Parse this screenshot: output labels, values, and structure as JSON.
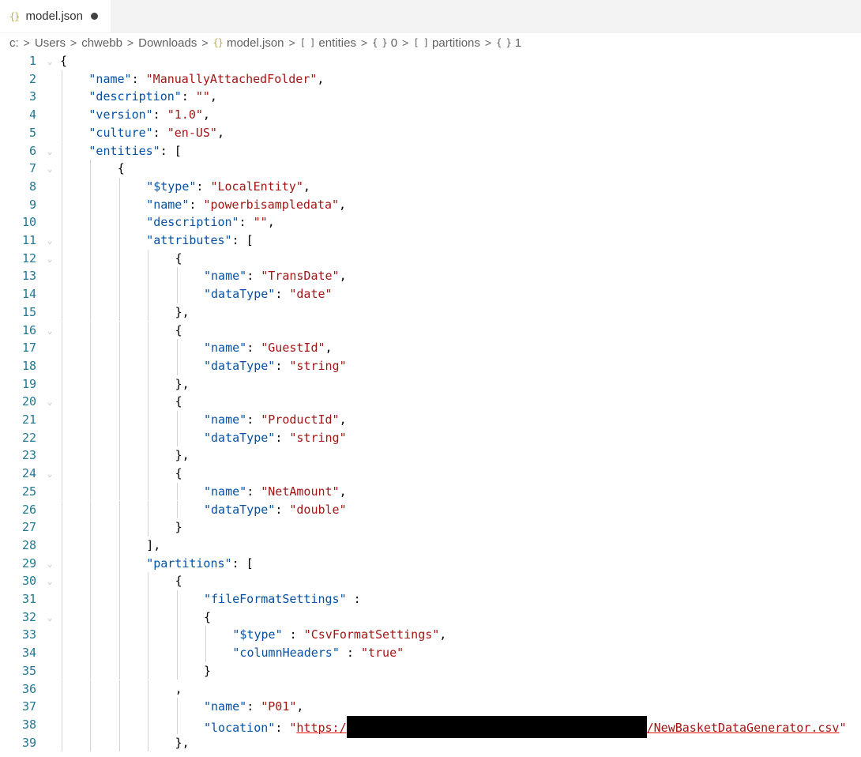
{
  "tab": {
    "label": "model.json",
    "icon": "json-braces-icon",
    "modified": true
  },
  "breadcrumb": [
    "c:",
    "Users",
    "chwebb",
    "Downloads",
    "model.json",
    "entities",
    "0",
    "partitions",
    "1"
  ],
  "editor": {
    "lines": [
      {
        "n": "1",
        "c": "{",
        "fold": true,
        "indent": 0
      },
      {
        "n": "2",
        "c": "\"name\": \"ManuallyAttachedFolder\",",
        "indent": 1
      },
      {
        "n": "3",
        "c": "\"description\": \"\",",
        "indent": 1
      },
      {
        "n": "4",
        "c": "\"version\": \"1.0\",",
        "indent": 1
      },
      {
        "n": "5",
        "c": "\"culture\": \"en-US\",",
        "indent": 1
      },
      {
        "n": "6",
        "c": "\"entities\": [",
        "fold": true,
        "indent": 1
      },
      {
        "n": "7",
        "c": "{",
        "fold": true,
        "indent": 2
      },
      {
        "n": "8",
        "c": "\"$type\": \"LocalEntity\",",
        "indent": 3
      },
      {
        "n": "9",
        "c": "\"name\": \"powerbisampledata\",",
        "indent": 3
      },
      {
        "n": "10",
        "c": "\"description\": \"\",",
        "indent": 3
      },
      {
        "n": "11",
        "c": "\"attributes\": [",
        "fold": true,
        "indent": 3
      },
      {
        "n": "12",
        "c": "{",
        "fold": true,
        "indent": 4
      },
      {
        "n": "13",
        "c": "\"name\": \"TransDate\",",
        "indent": 5
      },
      {
        "n": "14",
        "c": "\"dataType\": \"date\"",
        "indent": 5
      },
      {
        "n": "15",
        "c": "},",
        "indent": 4
      },
      {
        "n": "16",
        "c": "{",
        "fold": true,
        "indent": 4
      },
      {
        "n": "17",
        "c": "\"name\": \"GuestId\",",
        "indent": 5
      },
      {
        "n": "18",
        "c": "\"dataType\": \"string\"",
        "indent": 5
      },
      {
        "n": "19",
        "c": "},",
        "indent": 4
      },
      {
        "n": "20",
        "c": "{",
        "fold": true,
        "indent": 4
      },
      {
        "n": "21",
        "c": "\"name\": \"ProductId\",",
        "indent": 5
      },
      {
        "n": "22",
        "c": "\"dataType\": \"string\"",
        "indent": 5
      },
      {
        "n": "23",
        "c": "},",
        "indent": 4
      },
      {
        "n": "24",
        "c": "{",
        "fold": true,
        "indent": 4
      },
      {
        "n": "25",
        "c": "\"name\": \"NetAmount\",",
        "indent": 5
      },
      {
        "n": "26",
        "c": "\"dataType\": \"double\"",
        "indent": 5
      },
      {
        "n": "27",
        "c": "}",
        "indent": 4
      },
      {
        "n": "28",
        "c": "],",
        "indent": 3
      },
      {
        "n": "29",
        "c": "\"partitions\": [",
        "fold": true,
        "indent": 3
      },
      {
        "n": "30",
        "c": "{",
        "fold": true,
        "indent": 4
      },
      {
        "n": "31",
        "c": "\"fileFormatSettings\" :",
        "indent": 5
      },
      {
        "n": "32",
        "c": "{",
        "fold": true,
        "indent": 5
      },
      {
        "n": "33",
        "c": "\"$type\" : \"CsvFormatSettings\",",
        "indent": 6
      },
      {
        "n": "34",
        "c": "\"columnHeaders\" : \"true\"",
        "indent": 6
      },
      {
        "n": "35",
        "c": "}",
        "indent": 5
      },
      {
        "n": "36",
        "c": ",",
        "indent": 4
      },
      {
        "n": "37",
        "c": "\"name\": \"P01\",",
        "indent": 5
      },
      {
        "n": "38",
        "c": "\"location\": \"https:/[REDACTED]/NewBasketDataGenerator.csv\"",
        "indent": 5,
        "url_prefix": "https:/",
        "url_suffix": "/NewBasketDataGenerator.csv"
      },
      {
        "n": "39",
        "c": "},",
        "indent": 4
      }
    ]
  }
}
